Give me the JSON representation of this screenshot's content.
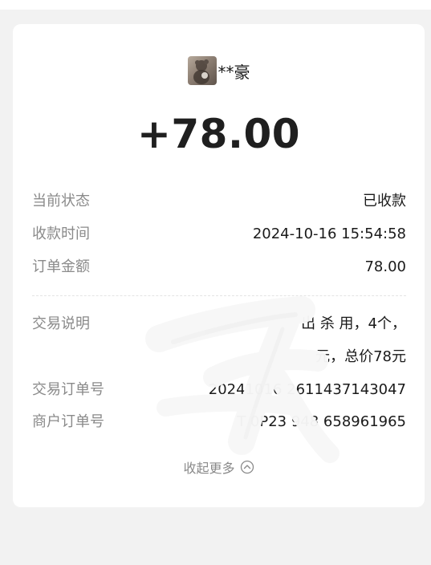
{
  "payer": {
    "avatar_icon": "avatar-photo-icon",
    "name": "**豪"
  },
  "amount": "+78.00",
  "details": [
    {
      "label": "当前状态",
      "value": "已收款"
    },
    {
      "label": "收款时间",
      "value": "2024-10-16 15:54:58"
    },
    {
      "label": "订单金额",
      "value": "78.00"
    }
  ],
  "transaction": {
    "desc_label": "交易说明",
    "desc_line1": "出                              杀               用，4个，",
    "desc_line2": "                            元，总价78元",
    "order_label": "交易订单号",
    "order_value": "20241016               2611437143047",
    "merchant_label": "商户订单号",
    "merchant_value": "T      0P23        948     658961965"
  },
  "footer": {
    "collapse_label": "收起更多",
    "collapse_icon": "chevron-up-circle-icon"
  },
  "colors": {
    "background": "#f2f2f2",
    "card": "#ffffff",
    "label": "#8a8a8a",
    "text": "#1a1a1a"
  }
}
